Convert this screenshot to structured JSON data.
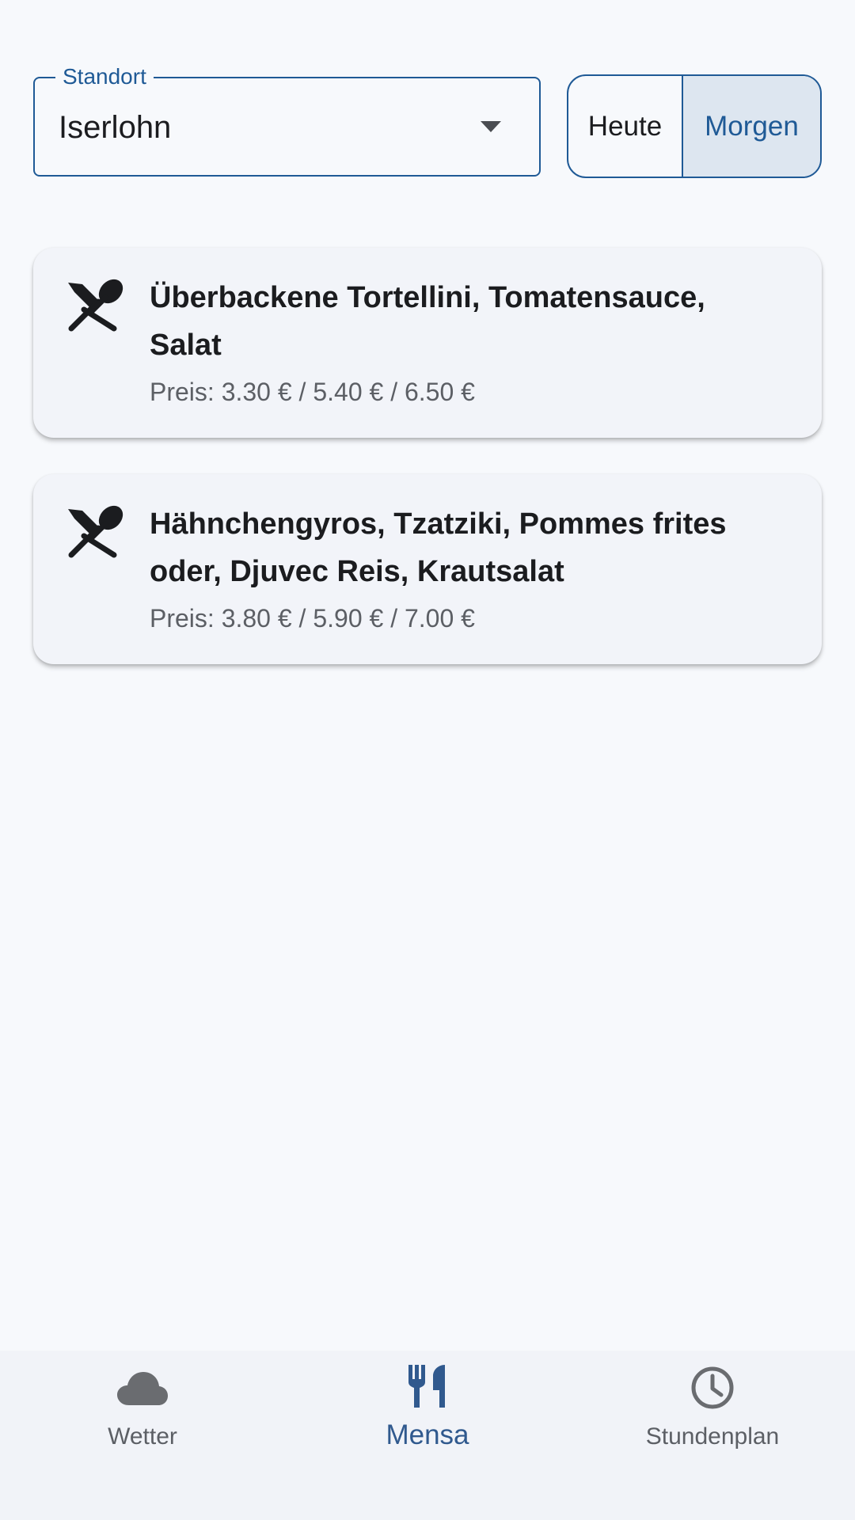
{
  "location": {
    "label": "Standort",
    "value": "Iserlohn"
  },
  "day_selector": {
    "options": [
      {
        "label": "Heute",
        "selected": false
      },
      {
        "label": "Morgen",
        "selected": true
      }
    ]
  },
  "meals": [
    {
      "title": "Überbackene Tortellini, Tomatensauce, Salat",
      "price": "Preis: 3.30 € / 5.40 € / 6.50 €",
      "icon": "restaurant-icon"
    },
    {
      "title": "Hähnchengyros, Tzatziki, Pommes frites oder, Djuvec Reis, Krautsalat",
      "price": "Preis: 3.80 € / 5.90 € / 7.00 €",
      "icon": "restaurant-icon"
    }
  ],
  "bottom_nav": {
    "items": [
      {
        "label": "Wetter",
        "icon": "cloud-icon",
        "active": false
      },
      {
        "label": "Mensa",
        "icon": "cutlery-icon",
        "active": true
      },
      {
        "label": "Stundenplan",
        "icon": "clock-icon",
        "active": false
      }
    ]
  },
  "colors": {
    "accent": "#1f5a96",
    "background": "#f7f9fc",
    "card": "#f2f4f9",
    "selected_segment": "#dde6f0",
    "nav_active": "#30598e"
  }
}
